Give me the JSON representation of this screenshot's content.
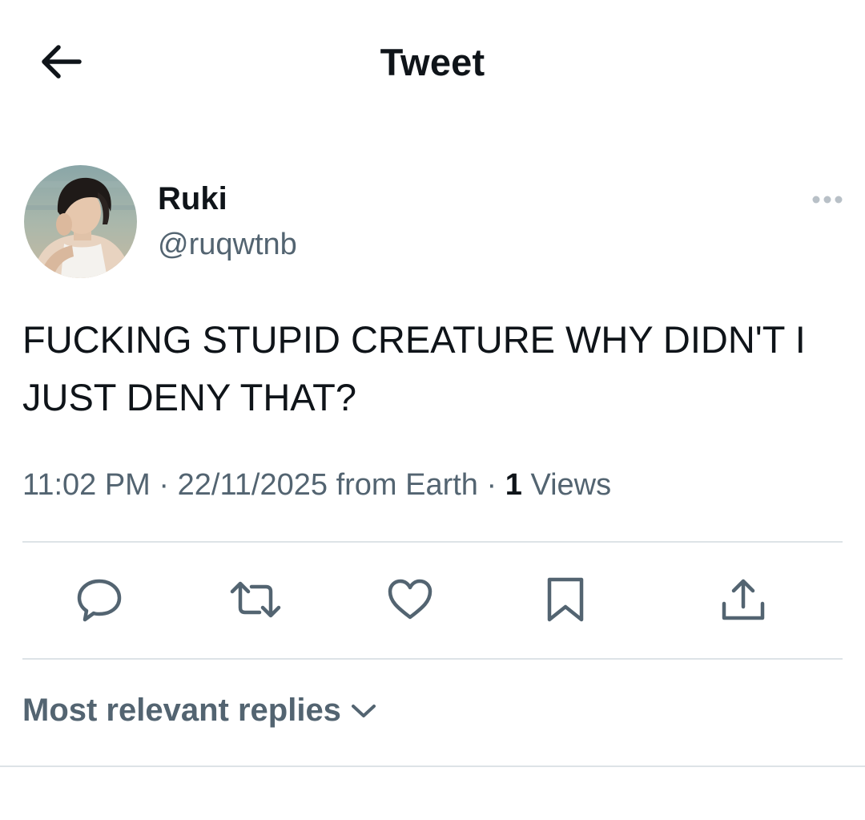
{
  "header": {
    "back_icon": "arrow-left-icon",
    "title": "Tweet"
  },
  "tweet": {
    "author": {
      "display_name": "Ruki",
      "handle": "@ruqwtnb",
      "avatar": "profile-photo"
    },
    "more_icon": "more-horizontal-icon",
    "text": "FUCKING STUPID CREATURE WHY DIDN'T I JUST DENY THAT?",
    "meta": {
      "time": "11:02 PM",
      "separator": "·",
      "date": "22/11/2025",
      "source": "from Earth",
      "views_count": "1",
      "views_label": "Views"
    },
    "actions": [
      {
        "name": "reply",
        "icon": "reply-icon"
      },
      {
        "name": "retweet",
        "icon": "retweet-icon"
      },
      {
        "name": "like",
        "icon": "heart-icon"
      },
      {
        "name": "bookmark",
        "icon": "bookmark-icon"
      },
      {
        "name": "share",
        "icon": "share-icon"
      }
    ]
  },
  "replies": {
    "sort_label": "Most relevant replies",
    "sort_icon": "chevron-down-icon"
  },
  "colors": {
    "text_primary": "#0f1419",
    "text_secondary": "#536471",
    "divider": "#dde3e7",
    "background": "#ffffff"
  }
}
